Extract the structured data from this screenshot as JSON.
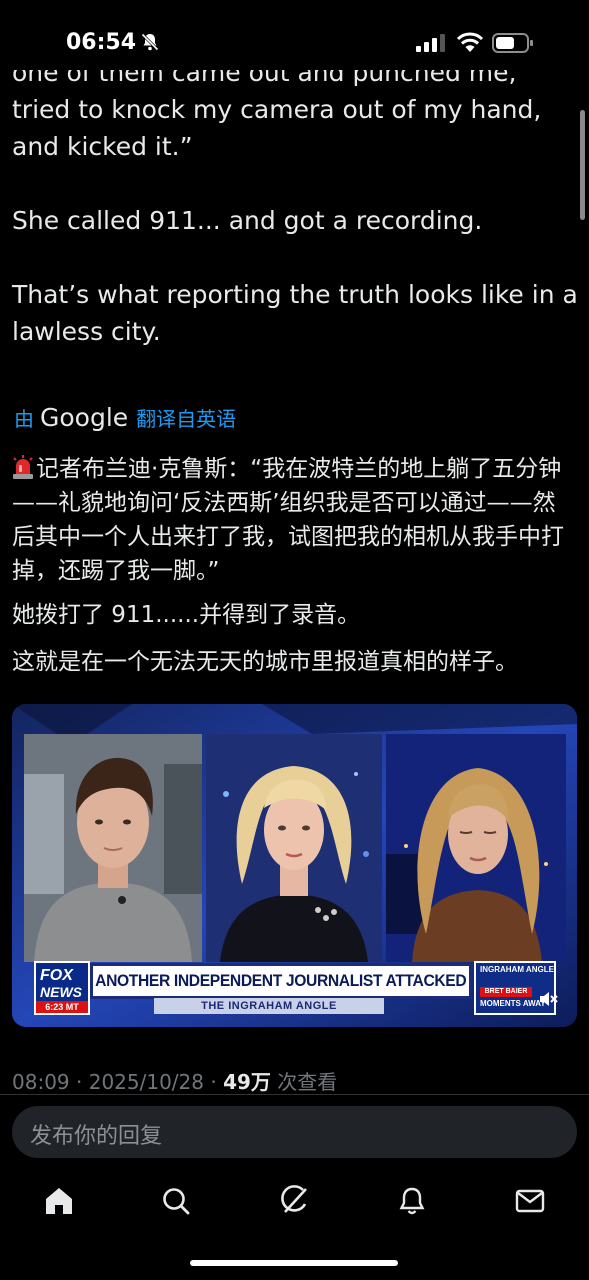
{
  "status_bar": {
    "time": "06:54",
    "icons": [
      "bell-slash-icon",
      "cellular-signal-icon",
      "wifi-icon",
      "battery-icon"
    ]
  },
  "tweet": {
    "text": "one of them came out and punched me, tried to knock my camera out of my hand, and kicked it.”\n\nShe called 911... and got a recording.\n\nThat’s what reporting the truth looks like in a lawless city.",
    "translate": {
      "prefix": "由",
      "brand": "Google",
      "suffix": "翻译自英语"
    },
    "translation": {
      "line_1": "记者布兰迪·克鲁斯：“我在波特兰的地上躺了五分钟——礼貌地询问‘反法西斯’组织我是否可以通过——然后其中一个人出来打了我，试图把我的相机从我手中打掉，还踢了我一脚。”",
      "line_2": "她拨打了 911......并得到了录音。",
      "line_3": "这就是在一个无法无天的城市里报道真相的样子。"
    },
    "video": {
      "headline": "ANOTHER INDEPENDENT JOURNALIST ATTACKED",
      "show": "THE INGRAHAM ANGLE",
      "network_top": "FOX",
      "network_bottom": "NEWS",
      "time_stamp": "6:23 MT",
      "promo_top": "INGRAHAM ANGLE",
      "promo_mid": "BRET BAIER",
      "promo_bottom": "MOMENTS AWAY"
    },
    "meta": {
      "time": "08:09",
      "date": "2025/10/28",
      "views_count": "49万",
      "views_label": "次查看"
    }
  },
  "reply": {
    "placeholder": "发布你的回复"
  },
  "nav": {
    "items": [
      "home-icon",
      "search-icon",
      "grok-icon",
      "notifications-icon",
      "messages-icon"
    ]
  },
  "colors": {
    "background": "#000000",
    "text": "#e7e9ea",
    "muted": "#71767b",
    "link": "#1d9bf0",
    "input_bg": "#202327"
  }
}
